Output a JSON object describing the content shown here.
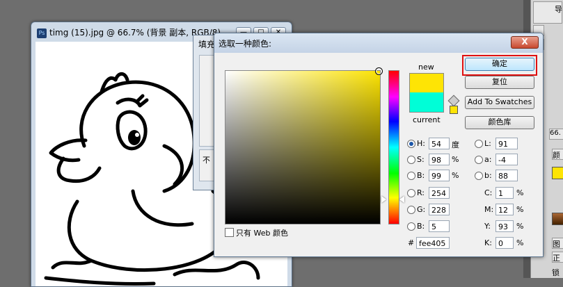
{
  "document": {
    "title": "timg (15).jpg @ 66.7% (背景 副本, RGB/8)",
    "app_icon": "ps-icon",
    "ps_label": "Ps",
    "btn_minimize": "—",
    "btn_maximize": "□",
    "btn_close": "✕"
  },
  "fill_dialog": {
    "title": "填充",
    "clip_text": "不"
  },
  "picker": {
    "title": "选取一种颜色:",
    "close": "X",
    "new_label": "new",
    "current_label": "current",
    "new_color": "#fee405",
    "current_color": "#00fed7",
    "buttons": {
      "ok": "确定",
      "reset": "复位",
      "swatches": "Add To Swatches",
      "libraries": "颜色库"
    },
    "hsb": {
      "h_label": "H:",
      "h_value": "54",
      "h_unit": "度",
      "s_label": "S:",
      "s_value": "98",
      "s_unit": "%",
      "b_label": "B:",
      "b_value": "99",
      "b_unit": "%"
    },
    "lab": {
      "l_label": "L:",
      "l_value": "91",
      "a_label": "a:",
      "a_value": "-4",
      "b_label": "b:",
      "b_value": "88"
    },
    "rgb": {
      "r_label": "R:",
      "r_value": "254",
      "g_label": "G:",
      "g_value": "228",
      "b_label": "B:",
      "b_value": "5"
    },
    "cmyk": {
      "c_label": "C:",
      "c_value": "1",
      "c_unit": "%",
      "m_label": "M:",
      "m_value": "12",
      "m_unit": "%",
      "y_label": "Y:",
      "y_value": "93",
      "y_unit": "%",
      "k_label": "K:",
      "k_value": "0",
      "k_unit": "%"
    },
    "hex_label": "#",
    "hex_value": "fee405",
    "web_only_label": "只有 Web 颜色"
  },
  "right_panel": {
    "tab1": "导",
    "val1": "66.",
    "tab2": "颜",
    "tab3": "图",
    "mode": "正",
    "lock": "锁"
  }
}
